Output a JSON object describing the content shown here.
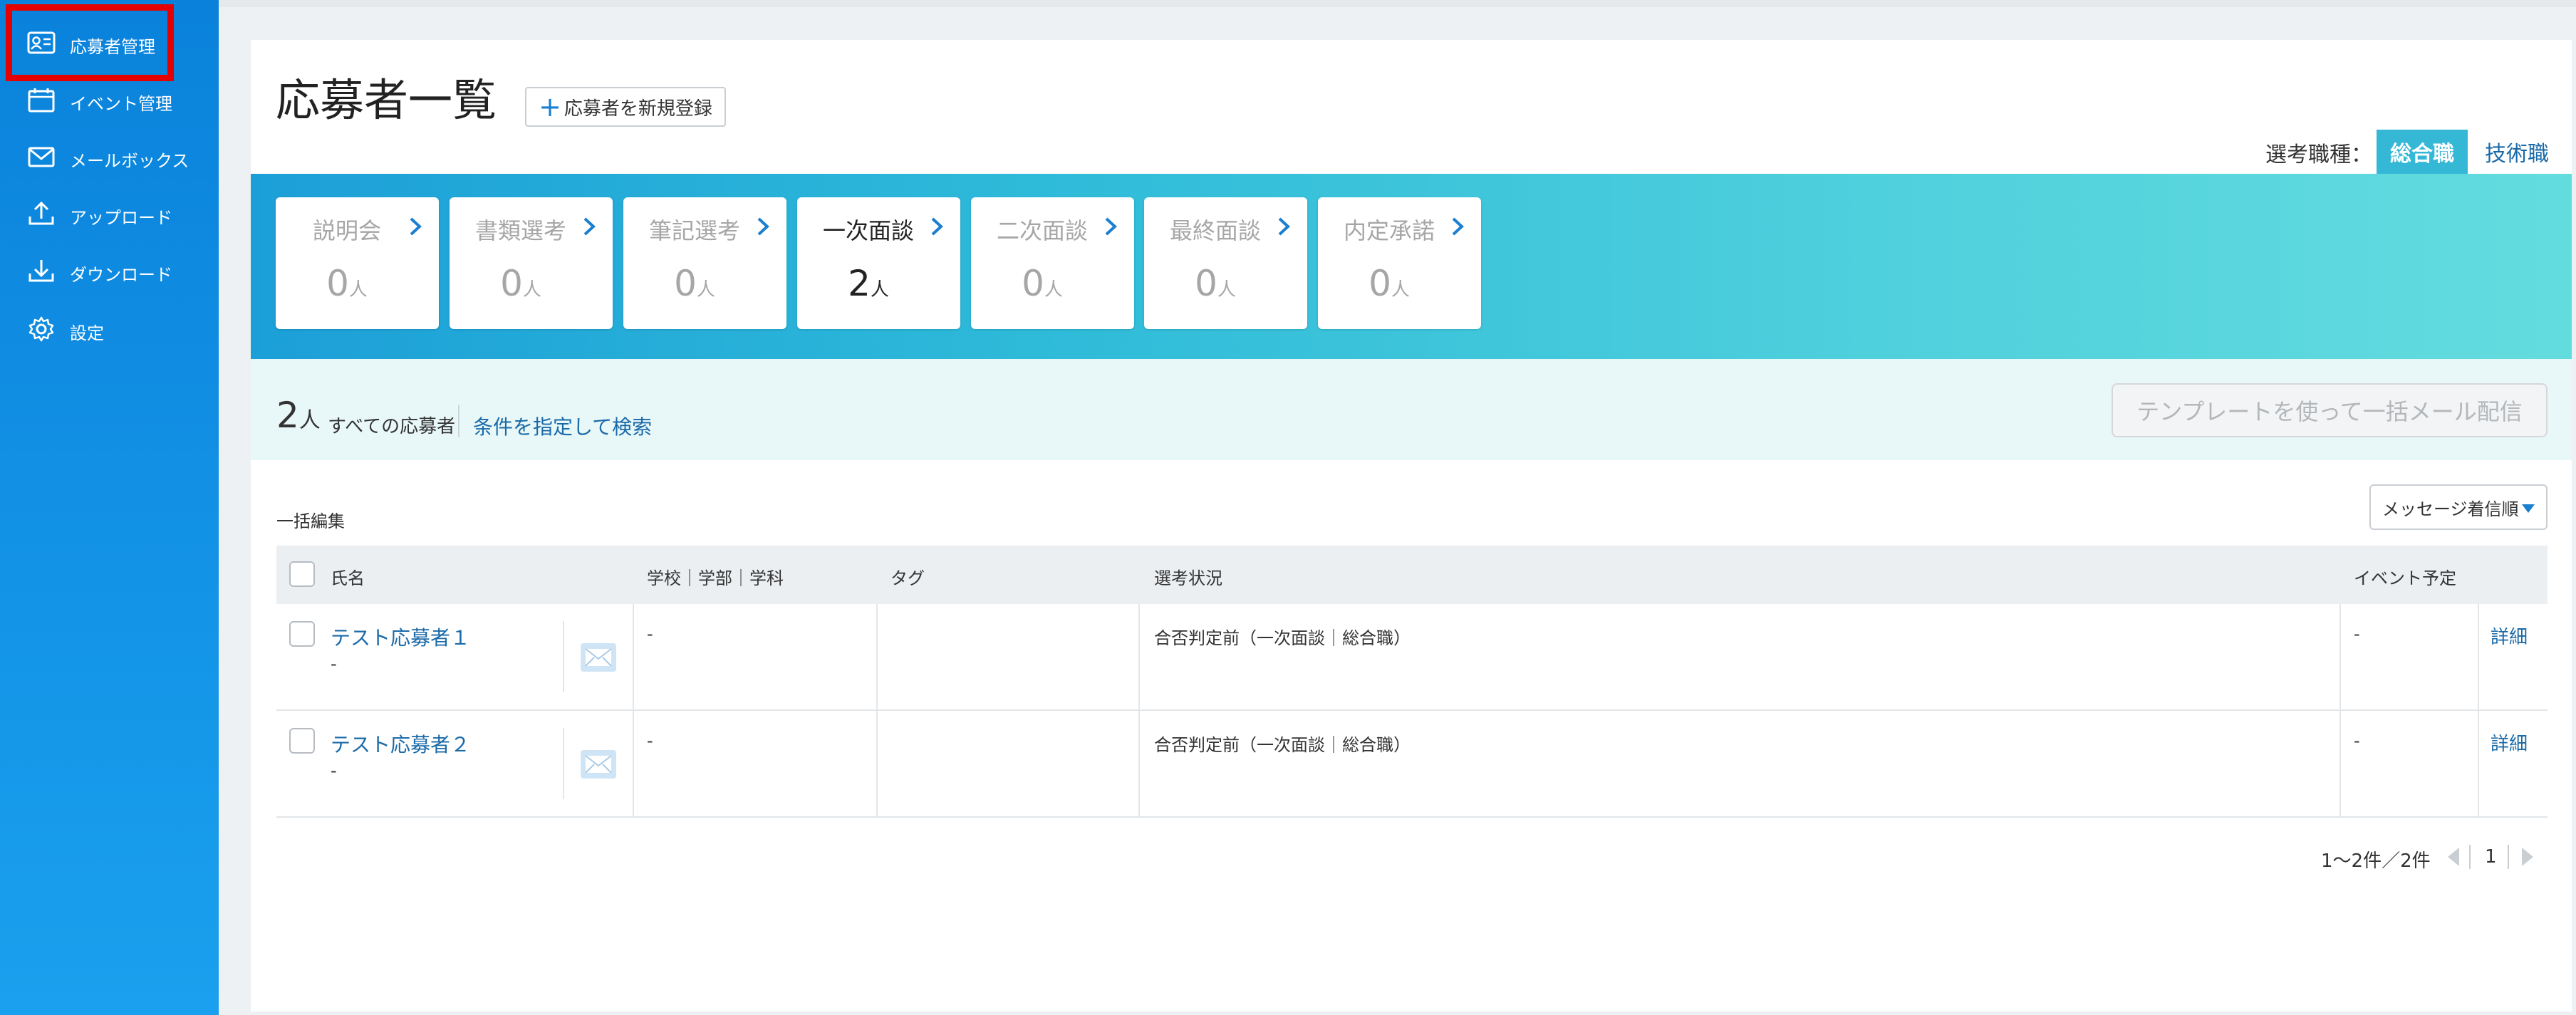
{
  "sidebar": {
    "items": [
      {
        "label": "応募者管理",
        "icon": "applicant-card-icon"
      },
      {
        "label": "イベント管理",
        "icon": "calendar-icon"
      },
      {
        "label": "メールボックス",
        "icon": "mail-icon"
      },
      {
        "label": "アップロード",
        "icon": "upload-icon"
      },
      {
        "label": "ダウンロード",
        "icon": "download-icon"
      },
      {
        "label": "設定",
        "icon": "gear-icon"
      }
    ],
    "active_index": 0
  },
  "header": {
    "title": "応募者一覧",
    "new_button": "応募者を新規登録",
    "job_label": "選考職種：",
    "job_tabs": [
      "総合職",
      "技術職"
    ],
    "job_selected": "総合職"
  },
  "stages": [
    {
      "name": "説明会",
      "count": "0",
      "unit": "人"
    },
    {
      "name": "書類選考",
      "count": "0",
      "unit": "人"
    },
    {
      "name": "筆記選考",
      "count": "0",
      "unit": "人"
    },
    {
      "name": "一次面談",
      "count": "2",
      "unit": "人"
    },
    {
      "name": "二次面談",
      "count": "0",
      "unit": "人"
    },
    {
      "name": "最終面談",
      "count": "0",
      "unit": "人"
    },
    {
      "name": "内定承諾",
      "count": "0",
      "unit": "人"
    }
  ],
  "summary": {
    "count": "2",
    "unit": "人",
    "label": "すべての応募者",
    "search_link": "条件を指定して検索",
    "bulk_mail_button": "テンプレートを使って一括メール配信"
  },
  "list": {
    "bulk_edit": "一括編集",
    "sort": "メッセージ着信順",
    "columns": {
      "name": "氏名",
      "school": "学校｜学部｜学科",
      "tag": "タグ",
      "status": "選考状況",
      "event": "イベント予定"
    },
    "rows": [
      {
        "name": "テスト応募者１",
        "sub": "-",
        "school": "-",
        "tag": "",
        "status": "合否判定前（一次面談｜総合職）",
        "event": "-",
        "detail": "詳細"
      },
      {
        "name": "テスト応募者２",
        "sub": "-",
        "school": "-",
        "tag": "",
        "status": "合否判定前（一次面談｜総合職）",
        "event": "-",
        "detail": "詳細"
      }
    ]
  },
  "pager": {
    "range": "1〜2件／2件",
    "page": "1"
  },
  "colors": {
    "sidebar": "#0a82db",
    "accent": "#1a7fd0",
    "link": "#1a6aa8",
    "band_start": "#1c9fd8",
    "band_end": "#63dcde",
    "job_tab_active": "#35b8d6",
    "highlight_box": "#e40000"
  }
}
